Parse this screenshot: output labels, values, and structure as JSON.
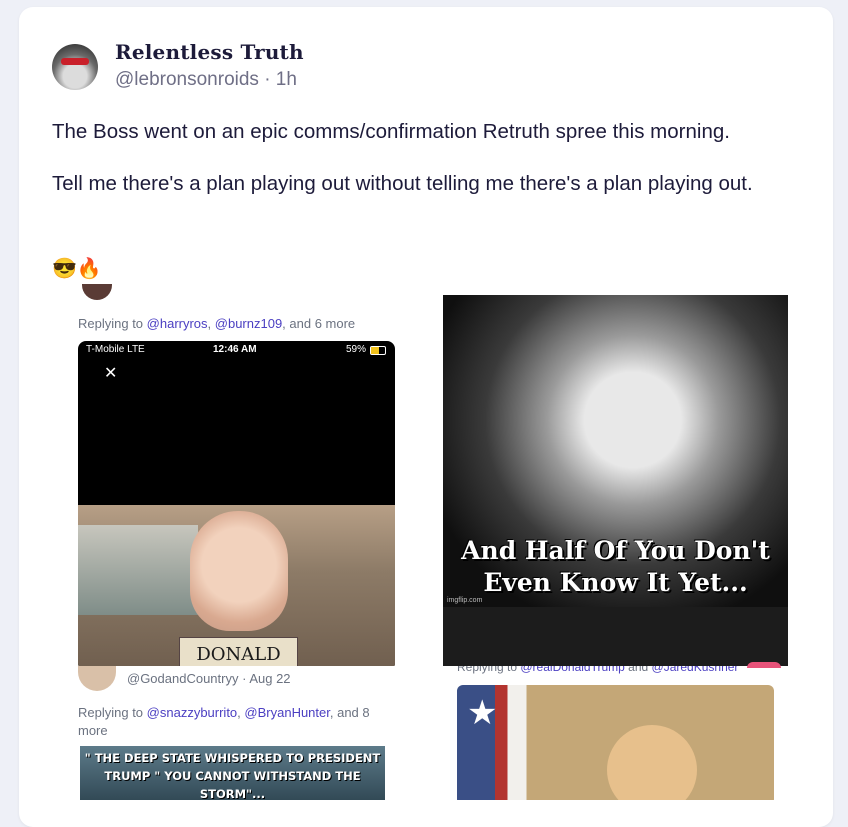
{
  "post": {
    "author_name": "Relentless Truth",
    "handle": "@lebronsonroids",
    "time": "· 1h",
    "paragraph_1": "The Boss went on an epic comms/confirmation Retruth spree this morning.",
    "paragraph_2": "Tell me there's a plan playing out without telling me there's a plan playing out.",
    "emojis": "😎🔥"
  },
  "media": {
    "top_left": {
      "replying_prefix": "Replying to ",
      "mention_1": "@harryros",
      "sep": ", ",
      "mention_2": "@burnz109",
      "suffix": ", and 6 more",
      "carrier": "T-Mobile  LTE",
      "clock": "12:46 AM",
      "battery": "59%",
      "close_glyph": "✕",
      "sign_text": "DONALD TRUMP"
    },
    "top_right": {
      "caption_line_1": "And Half Of You Don't",
      "caption_line_2": "Even Know It Yet...",
      "watermark": "imgflip.com"
    },
    "bottom_left": {
      "handle": "@GodandCountryy",
      "time": "· Aug 22",
      "replying_prefix": "Replying to ",
      "mention_1": "@snazzyburrito",
      "sep": ", ",
      "mention_2": "@BryanHunter",
      "suffix": ", and 8 more",
      "meme_line_1": "\" THE DEEP STATE WHISPERED TO PRESIDENT",
      "meme_line_2": "TRUMP \" YOU CANNOT WITHSTAND THE STORM\"..."
    },
    "bottom_right": {
      "replying_prefix": "Replying to ",
      "mention_1": "@realDonaldTrump",
      "and_text": " and ",
      "mention_2": "@JaredKushner"
    }
  }
}
